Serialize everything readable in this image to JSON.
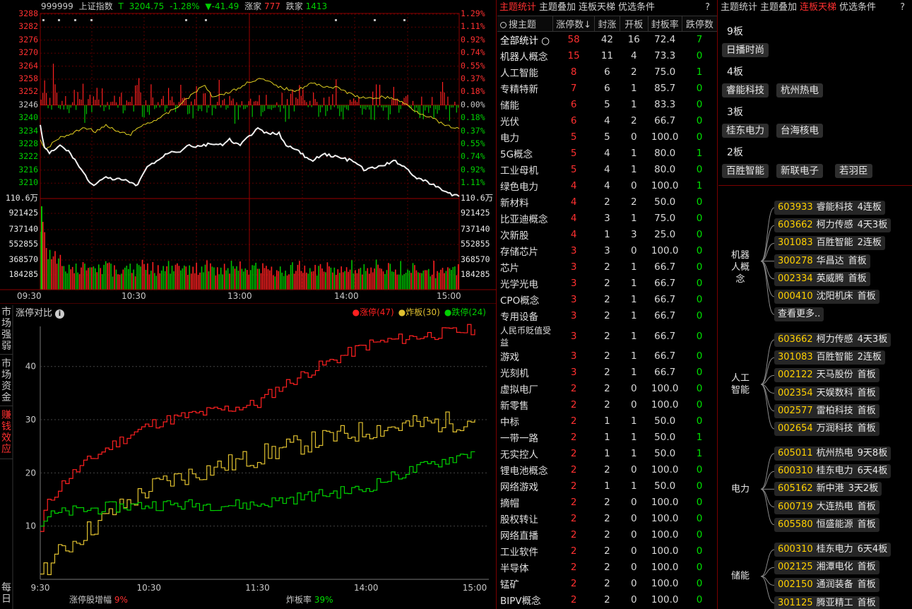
{
  "index_header": {
    "code": "999999",
    "name": "上证指数",
    "t_label": "T",
    "price": "3204.75",
    "pct": "-1.28%",
    "change": "▼-41.49",
    "up_label": "涨家",
    "up_count": "777",
    "down_label": "跌家",
    "down_count": "1413"
  },
  "price_axis": {
    "left": [
      "3288",
      "3282",
      "3276",
      "3270",
      "3264",
      "3258",
      "3252",
      "3246",
      "3240",
      "3234",
      "3228",
      "3222",
      "3216",
      "3210"
    ],
    "right": [
      "1.29%",
      "1.11%",
      "0.92%",
      "0.74%",
      "0.55%",
      "0.37%",
      "0.18%",
      "0.00%",
      "0.18%",
      "0.37%",
      "0.55%",
      "0.74%",
      "0.92%",
      "1.11%"
    ]
  },
  "volume_axis": {
    "left": [
      "110.6万",
      "921425",
      "737140",
      "552855",
      "368570",
      "184285"
    ],
    "right": [
      "110.6万",
      "921425",
      "737140",
      "552855",
      "368570",
      "184285"
    ]
  },
  "time_axis": [
    "09:30",
    "10:30",
    "13:00",
    "14:00",
    "15:00"
  ],
  "limit_panel": {
    "title": "涨停对比",
    "info_icon": "info-icon",
    "legend": [
      {
        "label": "涨停(47)",
        "color": "#ff2020"
      },
      {
        "label": "炸板(30)",
        "color": "#e0c030"
      },
      {
        "label": "跌停(24)",
        "color": "#00d000"
      }
    ],
    "y_ticks": [
      "40",
      "30",
      "20",
      "10"
    ],
    "x_ticks": [
      "9:30",
      "10:30",
      "11:30",
      "14:00",
      "15:00"
    ],
    "footer_left_label": "涨停股增幅",
    "footer_left_value": "9%",
    "footer_right_label": "炸板率",
    "footer_right_value": "39%"
  },
  "side_tabs": [
    "市场强弱",
    "市场资金",
    "赚钱效应",
    "每日"
  ],
  "chart_data": {
    "type": "line",
    "x": [
      "9:30",
      "10:30",
      "11:30",
      "14:00",
      "15:00"
    ],
    "series": [
      {
        "name": "涨停(47)",
        "color": "#ff2020",
        "values": [
          9,
          29,
          33,
          44,
          47
        ]
      },
      {
        "name": "炸板(30)",
        "color": "#e0c030",
        "values": [
          1,
          17,
          23,
          28,
          30
        ]
      },
      {
        "name": "跌停(24)",
        "color": "#00d000",
        "values": [
          10,
          14,
          14,
          17,
          24
        ]
      }
    ],
    "ylim": [
      0,
      47
    ]
  },
  "mid_tabs": [
    {
      "label": "主题统计",
      "active": true
    },
    {
      "label": "主题叠加",
      "active": false
    },
    {
      "label": "连板天梯",
      "active": false
    },
    {
      "label": "优选条件",
      "active": false
    }
  ],
  "help": "?",
  "table": {
    "search_placeholder": "搜主题",
    "headers": [
      "涨停数↓",
      "封涨",
      "开板",
      "封板率",
      "跌停数"
    ],
    "rows": [
      [
        "全部统计 ○",
        "58",
        "42",
        "16",
        "72.4",
        "7"
      ],
      [
        "机器人概念",
        "15",
        "11",
        "4",
        "73.3",
        "0"
      ],
      [
        "人工智能",
        "8",
        "6",
        "2",
        "75.0",
        "1"
      ],
      [
        "专精特新",
        "7",
        "6",
        "1",
        "85.7",
        "0"
      ],
      [
        "储能",
        "6",
        "5",
        "1",
        "83.3",
        "0"
      ],
      [
        "光伏",
        "6",
        "4",
        "2",
        "66.7",
        "0"
      ],
      [
        "电力",
        "5",
        "5",
        "0",
        "100.0",
        "0"
      ],
      [
        "5G概念",
        "5",
        "4",
        "1",
        "80.0",
        "1"
      ],
      [
        "工业母机",
        "5",
        "4",
        "1",
        "80.0",
        "0"
      ],
      [
        "绿色电力",
        "4",
        "4",
        "0",
        "100.0",
        "1"
      ],
      [
        "新材料",
        "4",
        "2",
        "2",
        "50.0",
        "0"
      ],
      [
        "比亚迪概念",
        "4",
        "3",
        "1",
        "75.0",
        "0"
      ],
      [
        "次新股",
        "4",
        "1",
        "3",
        "25.0",
        "0"
      ],
      [
        "存储芯片",
        "3",
        "3",
        "0",
        "100.0",
        "0"
      ],
      [
        "芯片",
        "3",
        "2",
        "1",
        "66.7",
        "0"
      ],
      [
        "光学光电",
        "3",
        "2",
        "1",
        "66.7",
        "0"
      ],
      [
        "CPO概念",
        "3",
        "2",
        "1",
        "66.7",
        "0"
      ],
      [
        "专用设备",
        "3",
        "2",
        "1",
        "66.7",
        "0"
      ],
      [
        "人民币贬值受益",
        "3",
        "2",
        "1",
        "66.7",
        "0"
      ],
      [
        "游戏",
        "3",
        "2",
        "1",
        "66.7",
        "0"
      ],
      [
        "光刻机",
        "3",
        "2",
        "1",
        "66.7",
        "0"
      ],
      [
        "虚拟电厂",
        "2",
        "2",
        "0",
        "100.0",
        "0"
      ],
      [
        "新零售",
        "2",
        "2",
        "0",
        "100.0",
        "0"
      ],
      [
        "中标",
        "2",
        "1",
        "1",
        "50.0",
        "0"
      ],
      [
        "一带一路",
        "2",
        "1",
        "1",
        "50.0",
        "1"
      ],
      [
        "无实控人",
        "2",
        "1",
        "1",
        "50.0",
        "1"
      ],
      [
        "锂电池概念",
        "2",
        "2",
        "0",
        "100.0",
        "0"
      ],
      [
        "网络游戏",
        "2",
        "1",
        "1",
        "50.0",
        "0"
      ],
      [
        "摘帽",
        "2",
        "2",
        "0",
        "100.0",
        "0"
      ],
      [
        "股权转让",
        "2",
        "2",
        "0",
        "100.0",
        "0"
      ],
      [
        "网络直播",
        "2",
        "2",
        "0",
        "100.0",
        "0"
      ],
      [
        "工业软件",
        "2",
        "2",
        "0",
        "100.0",
        "0"
      ],
      [
        "半导体",
        "2",
        "2",
        "0",
        "100.0",
        "0"
      ],
      [
        "锰矿",
        "2",
        "2",
        "0",
        "100.0",
        "0"
      ],
      [
        "BIPV概念",
        "2",
        "2",
        "0",
        "100.0",
        "0"
      ]
    ]
  },
  "right_tabs": [
    {
      "label": "主题统计",
      "active": false
    },
    {
      "label": "主题叠加",
      "active": false
    },
    {
      "label": "连板天梯",
      "active": true
    },
    {
      "label": "优选条件",
      "active": false
    }
  ],
  "ladder": [
    {
      "level": "9板",
      "stocks": [
        "日播时尚"
      ]
    },
    {
      "level": "4板",
      "stocks": [
        "睿能科技",
        "杭州热电"
      ]
    },
    {
      "level": "3板",
      "stocks": [
        "桂东电力",
        "台海核电"
      ]
    },
    {
      "level": "2板",
      "stocks": [
        "百胜智能",
        "新联电子",
        "若羽臣"
      ]
    }
  ],
  "groups": [
    {
      "name": "机器人概念",
      "items": [
        [
          "603933",
          "睿能科技",
          "4连板"
        ],
        [
          "603662",
          "柯力传感",
          "4天3板"
        ],
        [
          "301083",
          "百胜智能",
          "2连板"
        ],
        [
          "300278",
          "华昌达",
          "首板"
        ],
        [
          "002334",
          "英威腾",
          "首板"
        ],
        [
          "000410",
          "沈阳机床",
          "首板"
        ]
      ],
      "more": "查看更多.."
    },
    {
      "name": "人工智能",
      "items": [
        [
          "603662",
          "柯力传感",
          "4天3板"
        ],
        [
          "301083",
          "百胜智能",
          "2连板"
        ],
        [
          "002122",
          "天马股份",
          "首板"
        ],
        [
          "002354",
          "天娱数科",
          "首板"
        ],
        [
          "002577",
          "雷柏科技",
          "首板"
        ],
        [
          "002654",
          "万润科技",
          "首板"
        ]
      ]
    },
    {
      "name": "电力",
      "items": [
        [
          "605011",
          "杭州热电",
          "9天8板"
        ],
        [
          "600310",
          "桂东电力",
          "6天4板"
        ],
        [
          "605162",
          "新中港",
          "3天2板"
        ],
        [
          "600719",
          "大连热电",
          "首板"
        ],
        [
          "605580",
          "恒盛能源",
          "首板"
        ]
      ]
    },
    {
      "name": "储能",
      "items": [
        [
          "600310",
          "桂东电力",
          "6天4板"
        ],
        [
          "002125",
          "湘潭电化",
          "首板"
        ],
        [
          "002150",
          "通润装备",
          "首板"
        ],
        [
          "301125",
          "腾亚精工",
          "首板"
        ]
      ]
    }
  ]
}
